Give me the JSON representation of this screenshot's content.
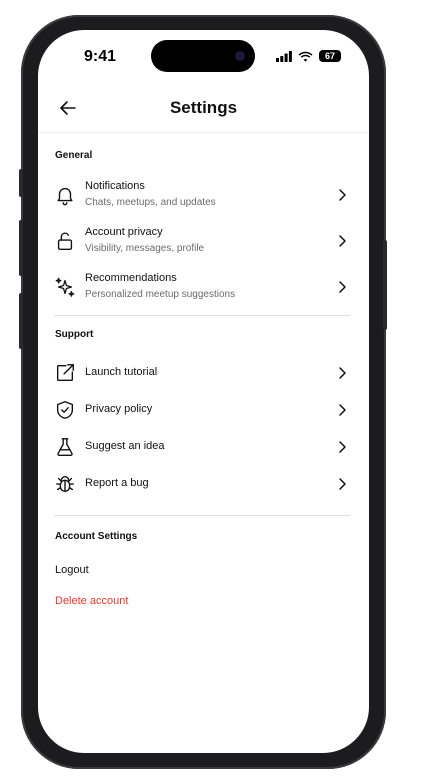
{
  "status_bar": {
    "time": "9:41",
    "battery": "67"
  },
  "header": {
    "title": "Settings"
  },
  "sections": {
    "general": {
      "label": "General",
      "items": [
        {
          "label": "Notifications",
          "subtitle": "Chats, meetups, and updates",
          "icon": "bell-icon"
        },
        {
          "label": "Account privacy",
          "subtitle": "Visibility, messages, profile",
          "icon": "lock-icon"
        },
        {
          "label": "Recommendations",
          "subtitle": "Personalized meetup suggestions",
          "icon": "sparkles-icon"
        }
      ]
    },
    "support": {
      "label": "Support",
      "items": [
        {
          "label": "Launch tutorial",
          "icon": "external-link-icon"
        },
        {
          "label": "Privacy policy",
          "icon": "shield-check-icon"
        },
        {
          "label": "Suggest an idea",
          "icon": "flask-icon"
        },
        {
          "label": "Report a bug",
          "icon": "bug-icon"
        }
      ]
    },
    "account_settings": {
      "label": "Account Settings",
      "logout": "Logout",
      "delete": "Delete account"
    }
  },
  "colors": {
    "danger": "#e5392b",
    "text": "#111111",
    "muted": "#6b6b6b"
  }
}
